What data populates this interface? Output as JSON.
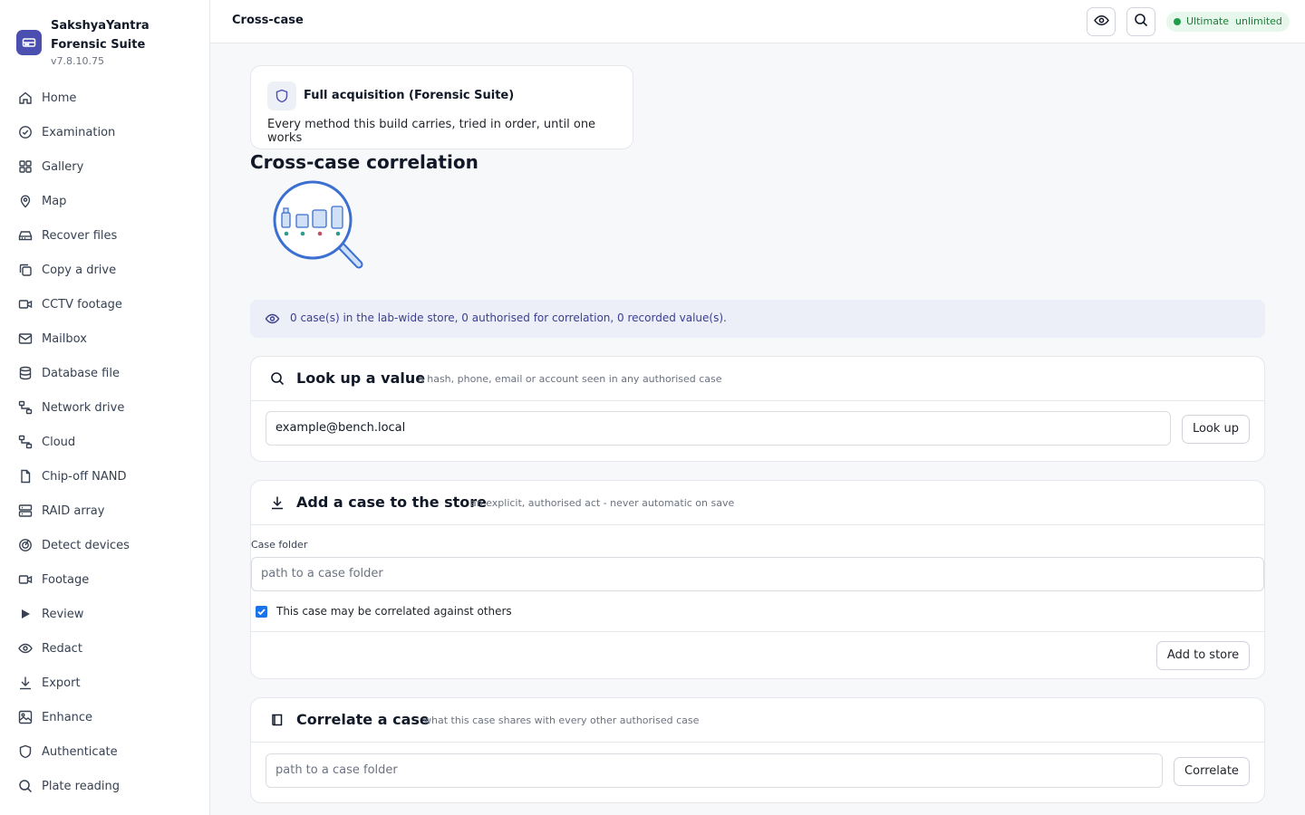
{
  "app": {
    "name": "SakshyaYantra Forensic Suite",
    "version": "v7.8.10.75",
    "brand_color": "#4b4fb0"
  },
  "sidebar": {
    "items": [
      {
        "label": "Home",
        "icon": "home-icon"
      },
      {
        "label": "Examination",
        "icon": "check-circle-icon"
      },
      {
        "label": "Gallery",
        "icon": "grid-icon"
      },
      {
        "label": "Map",
        "icon": "map-pin-icon"
      },
      {
        "label": "Recover files",
        "icon": "hard-drive-icon"
      },
      {
        "label": "Copy a drive",
        "icon": "copy-icon"
      },
      {
        "label": "CCTV footage",
        "icon": "video-icon"
      },
      {
        "label": "Mailbox",
        "icon": "mail-icon"
      },
      {
        "label": "Database file",
        "icon": "database-icon"
      },
      {
        "label": "Network drive",
        "icon": "network-icon"
      },
      {
        "label": "Cloud",
        "icon": "cloud-network-icon"
      },
      {
        "label": "Chip-off NAND",
        "icon": "chip-icon"
      },
      {
        "label": "RAID array",
        "icon": "server-icon"
      },
      {
        "label": "Detect devices",
        "icon": "radar-icon"
      },
      {
        "label": "Footage",
        "icon": "video-icon"
      },
      {
        "label": "Review",
        "icon": "play-icon"
      },
      {
        "label": "Redact",
        "icon": "eye-icon"
      },
      {
        "label": "Export",
        "icon": "download-icon"
      },
      {
        "label": "Enhance",
        "icon": "image-icon"
      },
      {
        "label": "Authenticate",
        "icon": "shield-icon"
      },
      {
        "label": "Plate reading",
        "icon": "search-icon"
      }
    ]
  },
  "topbar": {
    "title": "Cross-case",
    "license": "Ultimate  unlimited"
  },
  "mode_card": {
    "title": "Full acquisition (Forensic Suite)",
    "subtitle": "Every method this build carries, tried in order, until one works"
  },
  "page": {
    "title": "Cross-case correlation"
  },
  "info": {
    "text": "0 case(s) in the lab-wide store, 0 authorised for correlation, 0 recorded value(s)."
  },
  "lookup": {
    "title": "Look up a value",
    "hint": "a hash, phone, email or account seen in any authorised case",
    "value": "example@bench.local",
    "button": "Look up"
  },
  "add_case": {
    "title": "Add a case to the store",
    "hint": "an explicit, authorised act - never automatic on save",
    "field_label": "Case folder",
    "placeholder": "path to a case folder",
    "checkbox_label": "This case may be correlated against others",
    "checkbox_checked": true,
    "button": "Add to store"
  },
  "correlate": {
    "title": "Correlate a case",
    "hint": "what this case shares with every other authorised case",
    "placeholder": "path to a case folder",
    "button": "Correlate"
  }
}
